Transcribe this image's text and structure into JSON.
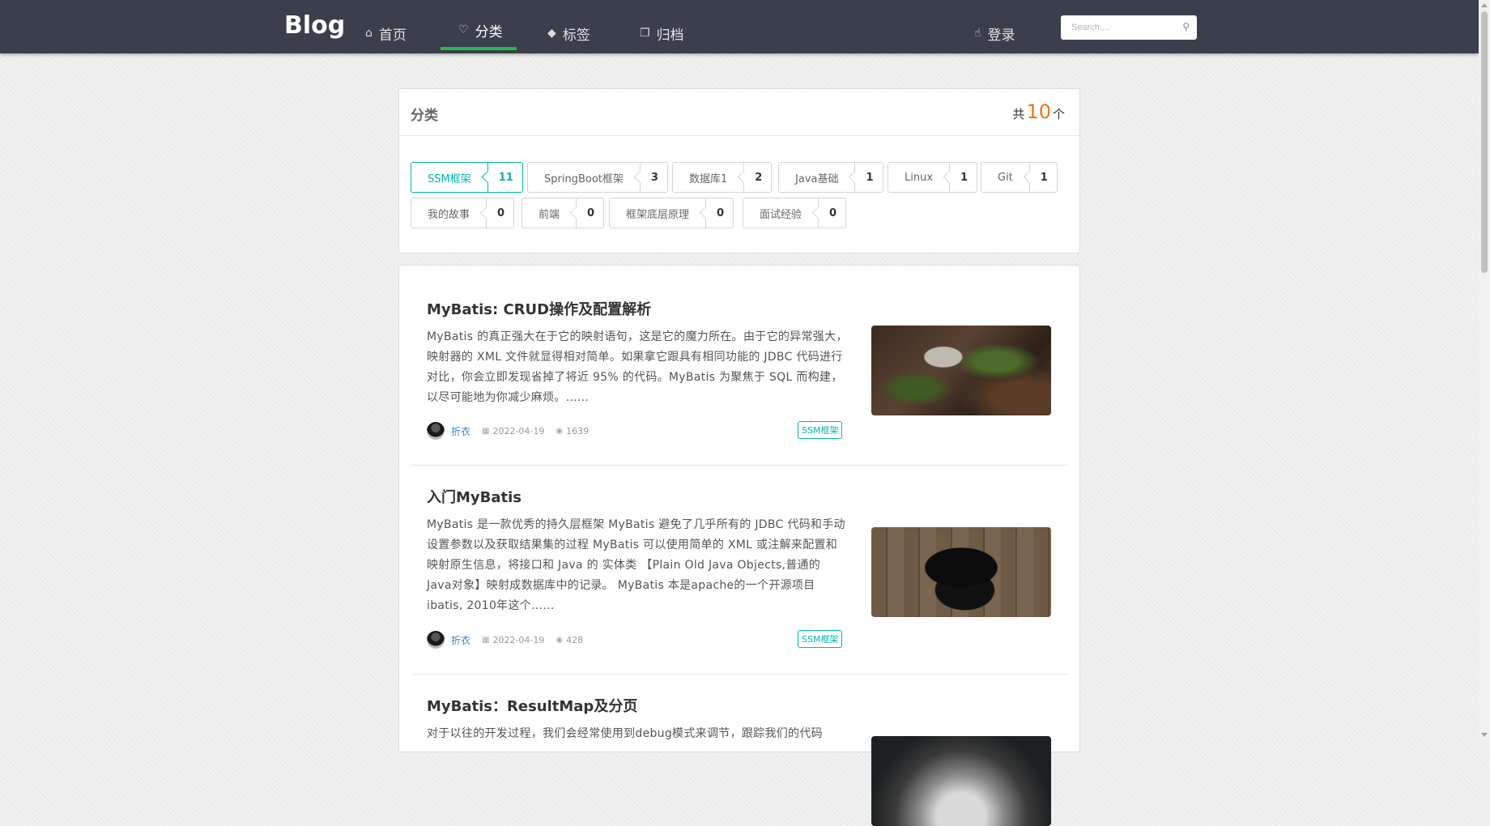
{
  "header": {
    "brand": "Blog",
    "nav": [
      {
        "label": "首页",
        "icon": "home-icon",
        "glyph": "⌂"
      },
      {
        "label": "分类",
        "icon": "lightbulb-icon",
        "glyph": "♡"
      },
      {
        "label": "标签",
        "icon": "tags-icon",
        "glyph": "◆"
      },
      {
        "label": "归档",
        "icon": "clone-icon",
        "glyph": "❐"
      }
    ],
    "active_nav": "分类",
    "login": {
      "label": "登录",
      "icon": "thumbs-up-icon",
      "glyph": "☝"
    },
    "search": {
      "placeholder": "Search....",
      "icon": "search-icon",
      "glyph": "⚲"
    }
  },
  "categories": {
    "title": "分类",
    "count_prefix": "共",
    "count": "10",
    "count_suffix": "个",
    "items": [
      {
        "name": "SSM框架",
        "count": "11",
        "selected": true
      },
      {
        "name": "SpringBoot框架",
        "count": "3"
      },
      {
        "name": "数据库1",
        "count": "2"
      },
      {
        "name": "Java基础",
        "count": "1"
      },
      {
        "name": "Linux",
        "count": "1"
      },
      {
        "name": "Git",
        "count": "1"
      },
      {
        "name": "我的故事",
        "count": "0"
      },
      {
        "name": "前端",
        "count": "0"
      },
      {
        "name": "框架底层原理",
        "count": "0"
      },
      {
        "name": "面试经验",
        "count": "0"
      }
    ]
  },
  "articles": [
    {
      "title": "MyBatis: CRUD操作及配置解析",
      "description": "MyBatis 的真正强大在于它的映射语句，这是它的魔力所在。由于它的异常强大，映射器的 XML 文件就显得相对简单。如果拿它跟具有相同功能的 JDBC 代码进行对比，你会立即发现省掉了将近 95% 的代码。MyBatis 为聚焦于 SQL 而构建，以尽可能地为你减少麻烦。……",
      "author": "折衣",
      "date": "2022-04-19",
      "views": "1639",
      "tag": "SSM框架"
    },
    {
      "title": "入门MyBatis",
      "description": "MyBatis 是一款优秀的持久层框架 MyBatis 避免了几乎所有的 JDBC 代码和手动设置参数以及获取结果集的过程 MyBatis 可以使用简单的 XML 或注解来配置和映射原生信息，将接口和 Java 的 实体类 【Plain Old Java Objects,普通的 Java对象】映射成数据库中的记录。 MyBatis 本是apache的一个开源项目ibatis, 2010年这个……",
      "author": "折衣",
      "date": "2022-04-19",
      "views": "428",
      "tag": "SSM框架"
    },
    {
      "title": "MyBatis：ResultMap及分页",
      "description": "对于以往的开发过程，我们会经常使用到debug模式来调节，跟踪我们的代码"
    }
  ]
}
